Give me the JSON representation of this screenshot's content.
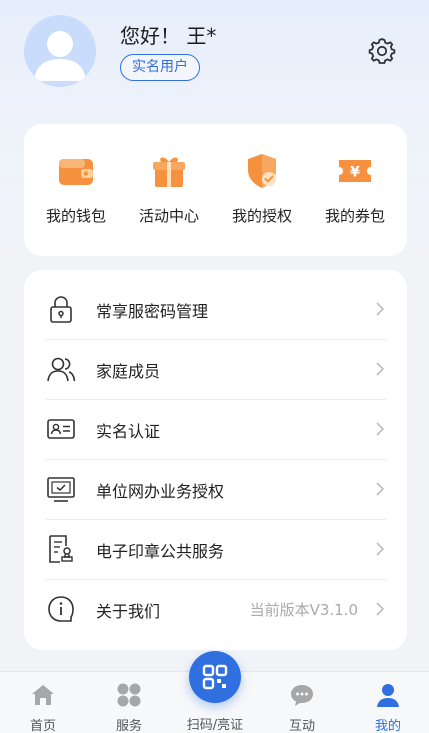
{
  "header": {
    "greeting": "您好！ 王*",
    "badge": "实名用户"
  },
  "quick_actions": [
    {
      "label": "我的钱包",
      "icon": "wallet-icon"
    },
    {
      "label": "活动中心",
      "icon": "gift-icon"
    },
    {
      "label": "我的授权",
      "icon": "shield-check-icon"
    },
    {
      "label": "我的券包",
      "icon": "coupon-icon"
    }
  ],
  "menu": [
    {
      "label": "常享服密码管理",
      "icon": "lock-icon",
      "extra": ""
    },
    {
      "label": "家庭成员",
      "icon": "family-icon",
      "extra": ""
    },
    {
      "label": "实名认证",
      "icon": "id-card-icon",
      "extra": ""
    },
    {
      "label": "单位网办业务授权",
      "icon": "monitor-check-icon",
      "extra": ""
    },
    {
      "label": "电子印章公共服务",
      "icon": "seal-document-icon",
      "extra": ""
    },
    {
      "label": "关于我们",
      "icon": "info-icon",
      "extra": "当前版本V3.1.0"
    }
  ],
  "tabbar": {
    "home": "首页",
    "services": "服务",
    "scan": "扫码/亮证",
    "interact": "互动",
    "mine": "我的"
  },
  "colors": {
    "accent": "#2f6fe0",
    "orange": "#f5913f"
  }
}
